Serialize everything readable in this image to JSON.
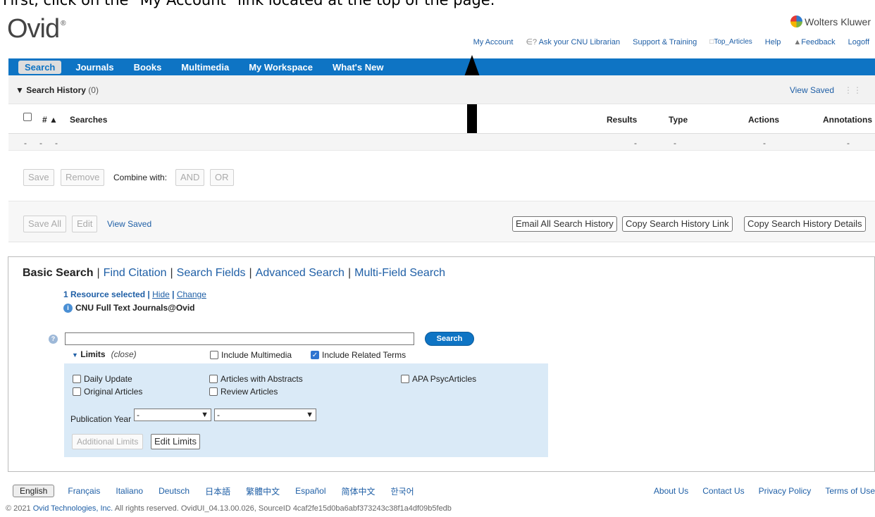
{
  "caption": "First, click on the \"My Account\" link located at the top of the page.",
  "logo": {
    "text": "Ovid",
    "mark": "®"
  },
  "brand": "Wolters Kluwer",
  "top_links": {
    "my_account": "My Account",
    "ask_librarian": "Ask your CNU Librarian",
    "support": "Support & Training",
    "top_articles": "Top_Articles",
    "help": "Help",
    "feedback": "Feedback",
    "logoff": "Logoff"
  },
  "nav": [
    "Search",
    "Journals",
    "Books",
    "Multimedia",
    "My Workspace",
    "What's New"
  ],
  "search_history": {
    "title": "Search History",
    "count": "(0)",
    "view_saved": "View Saved",
    "columns": {
      "num": "#",
      "searches": "Searches",
      "results": "Results",
      "type": "Type",
      "actions": "Actions",
      "annotations": "Annotations"
    },
    "empty_value": "-",
    "row_buttons": {
      "save": "Save",
      "remove": "Remove",
      "combine": "Combine with:",
      "and": "AND",
      "or": "OR"
    },
    "bottom_buttons": {
      "save_all": "Save All",
      "edit": "Edit",
      "view_saved": "View Saved",
      "email": "Email All Search History",
      "copy_link": "Copy Search History Link",
      "copy_details": "Copy Search History Details"
    }
  },
  "search_tabs": {
    "basic": "Basic Search",
    "find_citation": "Find Citation",
    "search_fields": "Search Fields",
    "advanced": "Advanced Search",
    "multi_field": "Multi-Field Search",
    "separator": "|"
  },
  "resource": {
    "selected": "1 Resource selected",
    "separator": "|",
    "hide": "Hide",
    "change": "Change",
    "name": "CNU Full Text Journals@Ovid"
  },
  "search": {
    "value": "",
    "button": "Search"
  },
  "limits": {
    "label": "Limits",
    "close": "(close)",
    "include_multimedia": "Include Multimedia",
    "include_related": "Include Related Terms",
    "options": {
      "daily_update": "Daily Update",
      "original_articles": "Original Articles",
      "with_abstracts": "Articles with Abstracts",
      "review_articles": "Review Articles",
      "apa": "APA PsycArticles"
    },
    "pub_year_label": "Publication Year",
    "pub_year_from": "-",
    "pub_year_to": "-",
    "additional": "Additional Limits",
    "edit": "Edit Limits"
  },
  "footer": {
    "languages": [
      "English",
      "Français",
      "Italiano",
      "Deutsch",
      "日本語",
      "繁體中文",
      "Español",
      "简体中文",
      "한국어"
    ],
    "links": [
      "About Us",
      "Contact Us",
      "Privacy Policy",
      "Terms of Use"
    ],
    "copyright_prefix": "© 2021",
    "company": "Ovid Technologies, Inc.",
    "copyright_suffix": "All rights reserved.   OvidUI_04.13.00.026, SourceID 4caf2fe15d0ba6abf373243c38f1a4df09b5fedb"
  },
  "colors": {
    "nav_blue": "#0e74c4",
    "link": "#1f5fa6",
    "limits_bg": "#daeaf7"
  }
}
